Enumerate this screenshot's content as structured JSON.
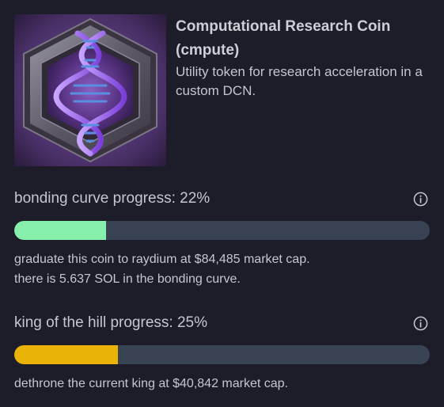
{
  "coin": {
    "name": "Computational Research Coin (cmpute)",
    "description": "Utility token for research acceleration in a custom DCN.",
    "image_icon": "dna-helix-hexagon-icon"
  },
  "bonding": {
    "title": "bonding curve progress: 22%",
    "progress_percent": 22,
    "fill_color": "#86efac",
    "note_line1": "graduate this coin to raydium at $84,485 market cap.",
    "note_line2": "there is 5.637 SOL in the bonding curve.",
    "info_icon": "info-icon"
  },
  "koth": {
    "title": "king of the hill progress: 25%",
    "progress_percent": 25,
    "fill_color": "#eab308",
    "note_line1": "dethrone the current king at $40,842 market cap.",
    "info_icon": "info-icon"
  },
  "colors": {
    "background": "#1c1d28",
    "track": "#394253",
    "text": "#c5c7cf"
  }
}
